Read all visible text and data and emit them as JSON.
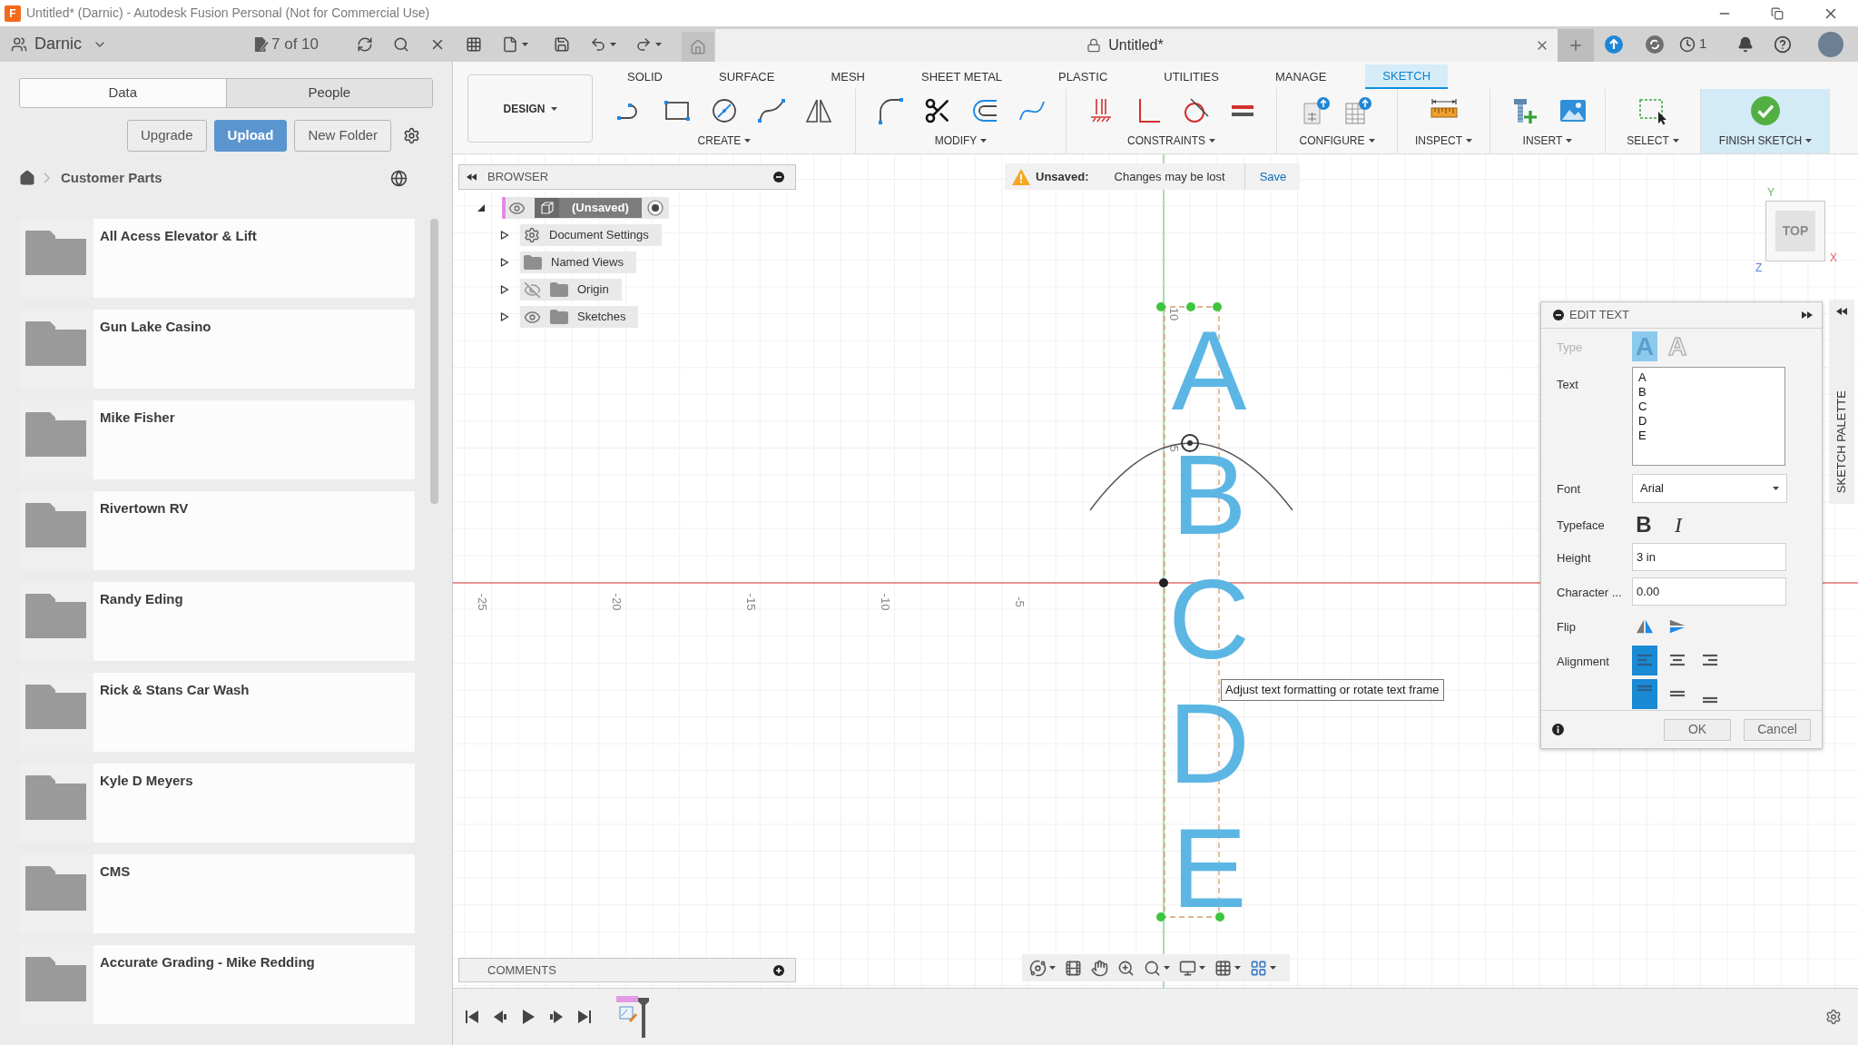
{
  "window": {
    "logo": "F",
    "title": "Untitled* (Darnic) - Autodesk Fusion Personal (Not for Commercial Use)"
  },
  "app_bar": {
    "team": "Darnic",
    "jobs": "7 of 10",
    "document_tab": "Untitled*",
    "clock_count": "1"
  },
  "data_panel": {
    "tabs": [
      {
        "label": "Data",
        "selected": true
      },
      {
        "label": "People",
        "selected": false
      }
    ],
    "buttons": [
      {
        "label": "Upgrade",
        "kind": "outline"
      },
      {
        "label": "Upload",
        "kind": "primary"
      },
      {
        "label": "New Folder",
        "kind": "outline"
      }
    ],
    "breadcrumb": "Customer Parts",
    "folders": [
      "All Acess Elevator & Lift",
      "Gun Lake Casino",
      "Mike Fisher",
      "Rivertown RV",
      "Randy Eding",
      "Rick & Stans Car Wash",
      "Kyle D Meyers",
      "CMS",
      "Accurate Grading - Mike Redding"
    ]
  },
  "toolbar": {
    "workspace": "DESIGN",
    "tabs": [
      {
        "label": "SOLID",
        "selected": false
      },
      {
        "label": "SURFACE",
        "selected": false
      },
      {
        "label": "MESH",
        "selected": false
      },
      {
        "label": "SHEET METAL",
        "selected": false
      },
      {
        "label": "PLASTIC",
        "selected": false
      },
      {
        "label": "UTILITIES",
        "selected": false
      },
      {
        "label": "MANAGE",
        "selected": false
      },
      {
        "label": "SKETCH",
        "selected": true
      }
    ],
    "groups": [
      {
        "label": "CREATE",
        "kind": "create"
      },
      {
        "label": "MODIFY",
        "kind": "modify"
      },
      {
        "label": "CONSTRAINTS",
        "kind": "constraints"
      },
      {
        "label": "CONFIGURE",
        "kind": "configure"
      },
      {
        "label": "INSPECT",
        "kind": "inspect"
      },
      {
        "label": "INSERT",
        "kind": "insert"
      },
      {
        "label": "SELECT",
        "kind": "select"
      },
      {
        "label": "FINISH SKETCH",
        "kind": "finish"
      }
    ]
  },
  "browser": {
    "title": "BROWSER",
    "items": [
      {
        "label": "(Unsaved)",
        "kind": "component",
        "selected": true,
        "expanded": true,
        "visible": true,
        "children": [
          {
            "label": "Document Settings",
            "kind": "settings",
            "selected": false,
            "expanded": false
          },
          {
            "label": "Named Views",
            "kind": "folder",
            "selected": false,
            "expanded": false
          },
          {
            "label": "Origin",
            "kind": "folder",
            "selected": false,
            "expanded": false,
            "visible": false
          },
          {
            "label": "Sketches",
            "kind": "folder",
            "selected": false,
            "expanded": false,
            "visible": true
          }
        ]
      }
    ]
  },
  "unsaved_banner": {
    "label": "Unsaved:",
    "message": "Changes may be lost",
    "action": "Save"
  },
  "canvas": {
    "x_ruler": [
      "-25",
      "-20",
      "-15",
      "-10",
      "-5"
    ],
    "y_ruler": [
      "10",
      "5"
    ],
    "sketch_text": [
      "A",
      "B",
      "C",
      "D",
      "E"
    ],
    "tooltip": "Adjust text formatting or rotate text frame"
  },
  "view_cube": {
    "face": "TOP",
    "axes": {
      "y": "Y",
      "x": "X",
      "z": "Z"
    }
  },
  "edit_text": {
    "title": "EDIT TEXT",
    "rows": [
      {
        "kind": "type",
        "label": "Type",
        "disabled": true,
        "options": [
          {
            "label": "A",
            "kind": "filled",
            "selected": true
          },
          {
            "label": "A",
            "kind": "outlined",
            "selected": false
          }
        ]
      },
      {
        "kind": "textarea",
        "label": "Text",
        "disabled": false,
        "lines": [
          "A",
          "B",
          "C",
          "D",
          "E"
        ]
      },
      {
        "kind": "select",
        "label": "Font",
        "disabled": false,
        "value": "Arial"
      },
      {
        "kind": "style",
        "label": "Typeface",
        "disabled": false,
        "options": [
          {
            "label": "B",
            "kind": "bold",
            "selected": false
          },
          {
            "label": "I",
            "kind": "italic",
            "selected": false
          }
        ]
      },
      {
        "kind": "input",
        "label": "Height",
        "disabled": false,
        "value": "3 in"
      },
      {
        "kind": "input",
        "label": "Character ...",
        "disabled": false,
        "value": "0.00"
      },
      {
        "kind": "flip",
        "label": "Flip",
        "disabled": false
      },
      {
        "kind": "alignment",
        "label": "Alignment",
        "disabled": false,
        "horizontal": [
          {
            "selected": true
          },
          {
            "selected": false
          },
          {
            "selected": false
          }
        ],
        "vertical": [
          {
            "selected": true
          },
          {
            "selected": false
          },
          {
            "selected": false
          }
        ]
      }
    ],
    "buttons": [
      "OK",
      "Cancel"
    ]
  },
  "sketch_palette": {
    "title": "SKETCH PALETTE"
  },
  "comments": {
    "title": "COMMENTS"
  }
}
